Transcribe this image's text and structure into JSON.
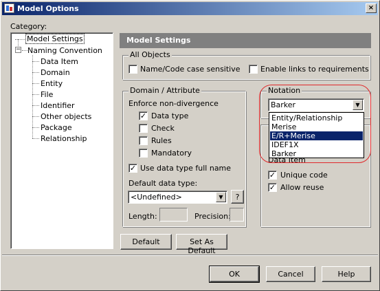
{
  "window": {
    "title": "Model Options",
    "close_label": "×"
  },
  "category": {
    "label": "Category:",
    "tree": [
      {
        "label": "Model Settings",
        "selected": true
      },
      {
        "label": "Naming Convention",
        "expander": "−"
      },
      {
        "label": "Data Item"
      },
      {
        "label": "Domain"
      },
      {
        "label": "Entity"
      },
      {
        "label": "File"
      },
      {
        "label": "Identifier"
      },
      {
        "label": "Other objects"
      },
      {
        "label": "Package"
      },
      {
        "label": "Relationship"
      }
    ]
  },
  "header": {
    "title": "Model Settings"
  },
  "all_objects": {
    "title": "All Objects",
    "name_code_case": {
      "label": "Name/Code case sensitive",
      "checked": false
    },
    "links_requirements": {
      "label": "Enable links to requirements",
      "checked": false
    }
  },
  "domain_attribute": {
    "title": "Domain / Attribute",
    "enforce_label": "Enforce non-divergence",
    "data_type": {
      "label": "Data type",
      "checked": true
    },
    "check": {
      "label": "Check",
      "checked": false
    },
    "rules": {
      "label": "Rules",
      "checked": false
    },
    "mandatory": {
      "label": "Mandatory",
      "checked": false
    },
    "use_full_name": {
      "label": "Use data type full name",
      "checked": true
    },
    "default_type_label": "Default data type:",
    "default_type_value": "<Undefined>",
    "help_button": "?",
    "length_label": "Length:",
    "precision_label": "Precision:"
  },
  "notation": {
    "title": "Notation",
    "selected": "Barker",
    "options": [
      "Entity/Relationship",
      "Merise",
      "E/R+Merise",
      "IDEF1X",
      "Barker"
    ],
    "highlighted_index": 2
  },
  "data_item": {
    "title": "Data Item",
    "unique_code": {
      "label": "Unique code",
      "checked": true
    },
    "allow_reuse": {
      "label": "Allow reuse",
      "checked": true
    }
  },
  "buttons": {
    "default": "Default",
    "set_as_default": "Set As Default",
    "ok": "OK",
    "cancel": "Cancel",
    "help": "Help"
  },
  "check_mark": "✓",
  "arrow_glyph": "▼",
  "colors": {
    "title_gradient_start": "#0a246a",
    "highlight": "#0a246a",
    "annotation_circle": "#e0282a",
    "header_bar": "#808080"
  }
}
